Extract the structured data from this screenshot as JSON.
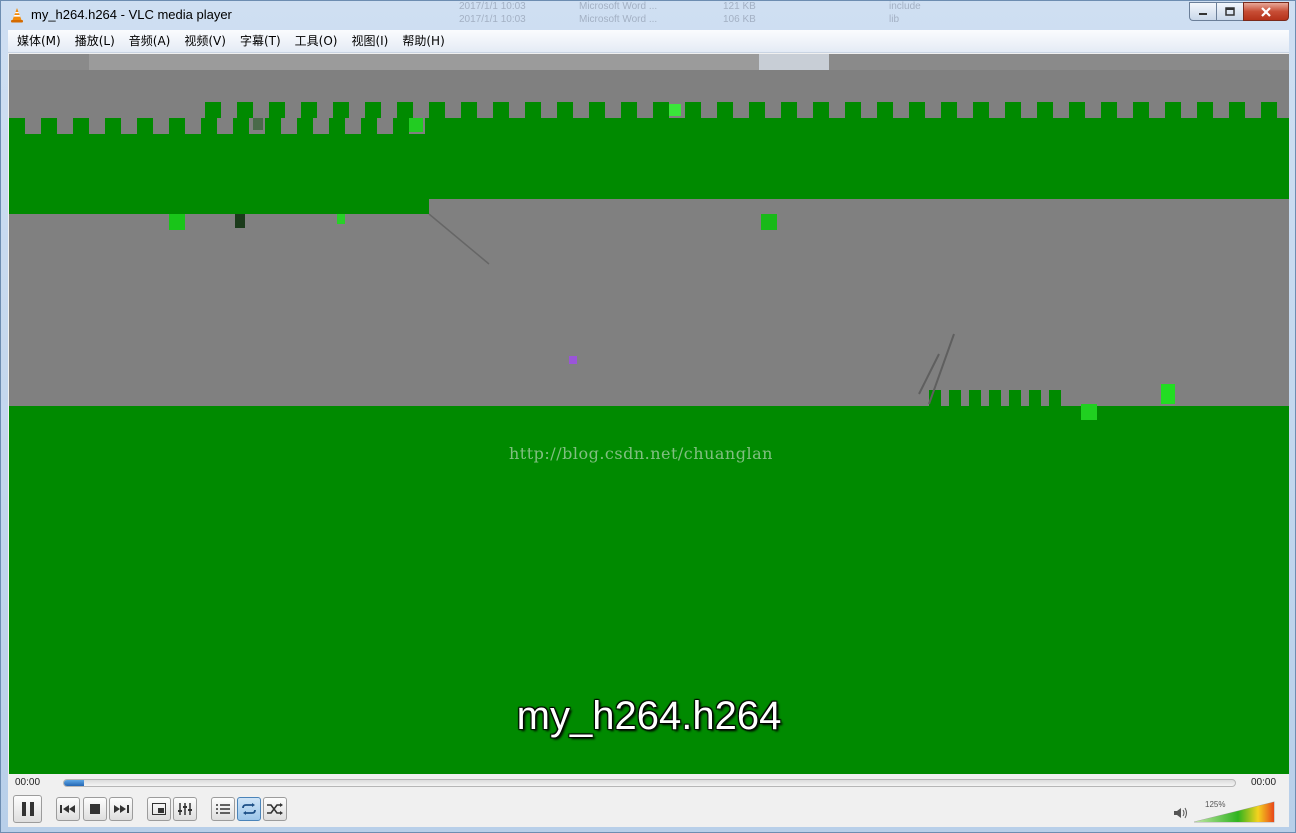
{
  "window": {
    "title": "my_h264.h264 - VLC media player",
    "background_ghost": [
      "2017/1/1 10:03",
      "Microsoft Word ...",
      "121 KB",
      "2017/1/1 10:03",
      "Microsoft Word ...",
      "106 KB",
      "include",
      "lib"
    ]
  },
  "menubar": {
    "items": [
      {
        "label": "媒体(M)",
        "name": "menu-media"
      },
      {
        "label": "播放(L)",
        "name": "menu-playback"
      },
      {
        "label": "音频(A)",
        "name": "menu-audio"
      },
      {
        "label": "视频(V)",
        "name": "menu-video"
      },
      {
        "label": "字幕(T)",
        "name": "menu-subtitle"
      },
      {
        "label": "工具(O)",
        "name": "menu-tools"
      },
      {
        "label": "视图(I)",
        "name": "menu-view"
      },
      {
        "label": "帮助(H)",
        "name": "menu-help"
      }
    ]
  },
  "video": {
    "watermark": "http://blog.csdn.net/chuanglan",
    "osd_title": "my_h264.h264"
  },
  "seek": {
    "elapsed": "00:00",
    "total": "00:00",
    "progress": 0.017
  },
  "volume": {
    "label": "125%",
    "level": 1.25
  },
  "colors": {
    "artifact_green": "#008a00",
    "artifact_gray": "#808080",
    "accent_blue": "#2466b4"
  },
  "icons": {
    "pause": "pause-icon",
    "prev": "previous-icon",
    "stop": "stop-icon",
    "next": "next-icon",
    "fullscreen": "fullscreen-icon",
    "extended": "extended-settings-icon",
    "playlist": "playlist-icon",
    "loop": "loop-icon",
    "shuffle": "shuffle-icon",
    "speaker": "speaker-icon"
  }
}
